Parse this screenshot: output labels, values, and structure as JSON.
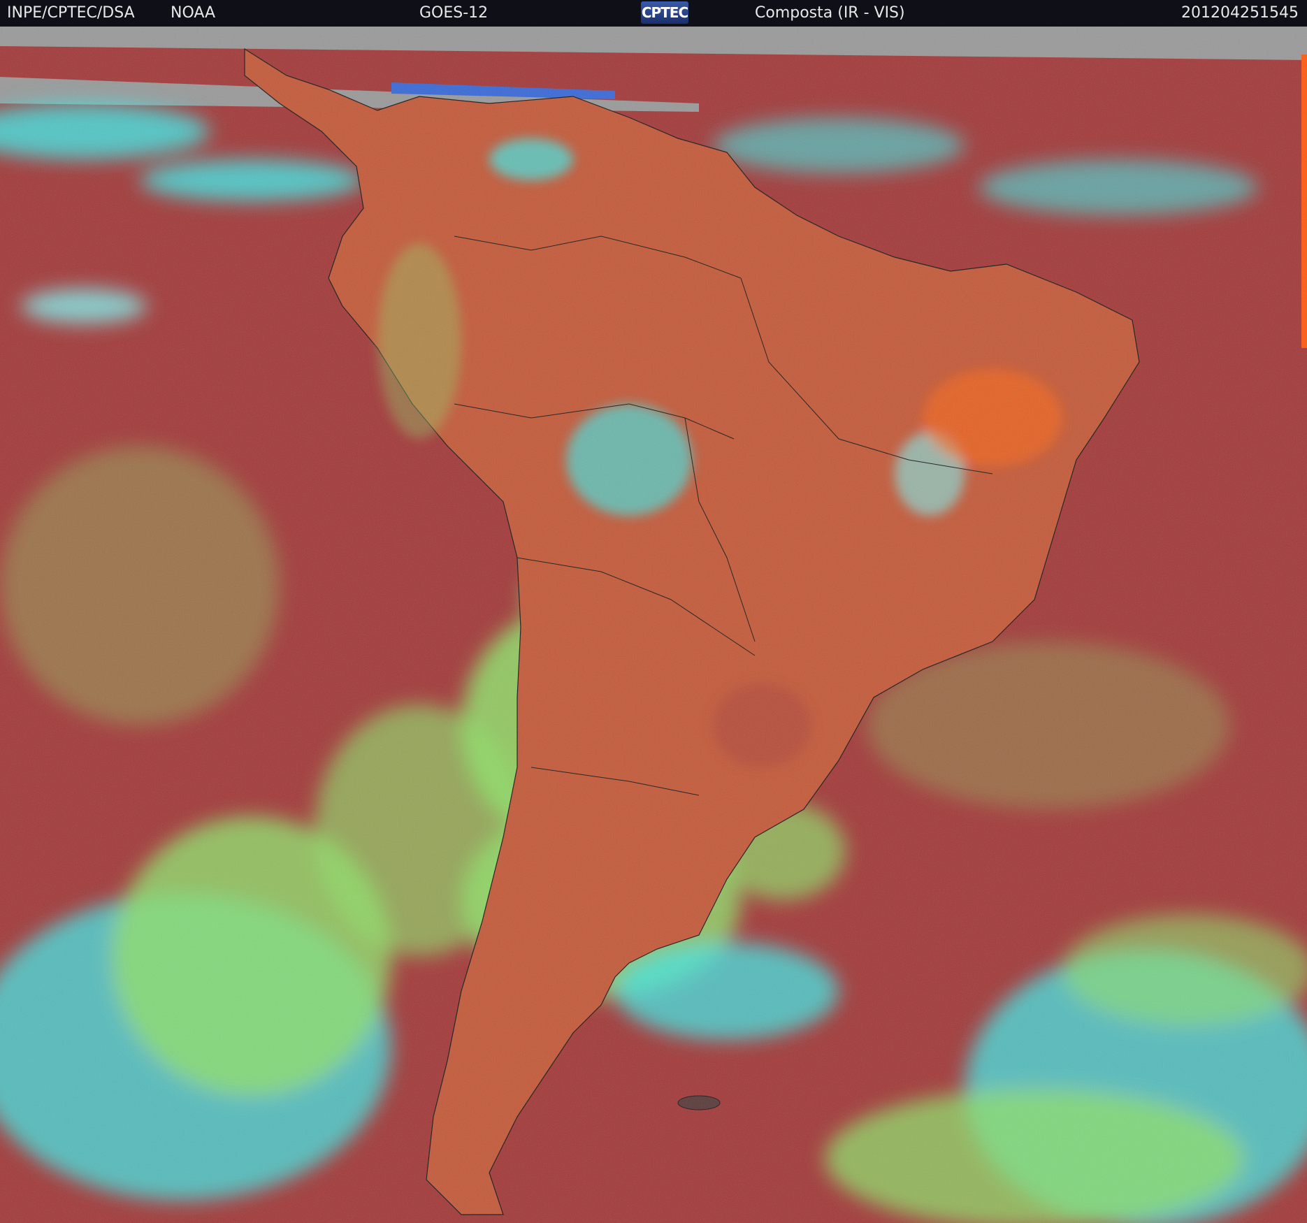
{
  "header": {
    "agency": "INPE/CPTEC/DSA",
    "partner": "NOAA",
    "satellite": "GOES-12",
    "logo_text": "CPTEC",
    "product": "Composta (IR - VIS)",
    "timestamp": "201204251545"
  },
  "colors": {
    "clear_ocean": "#a33a3a",
    "land": "#c45a3a",
    "low_cloud": "#8fe06a",
    "high_cloud": "#3fe8e8",
    "header_bg": "#0e0f17",
    "no_data": "#9a9a9a"
  }
}
